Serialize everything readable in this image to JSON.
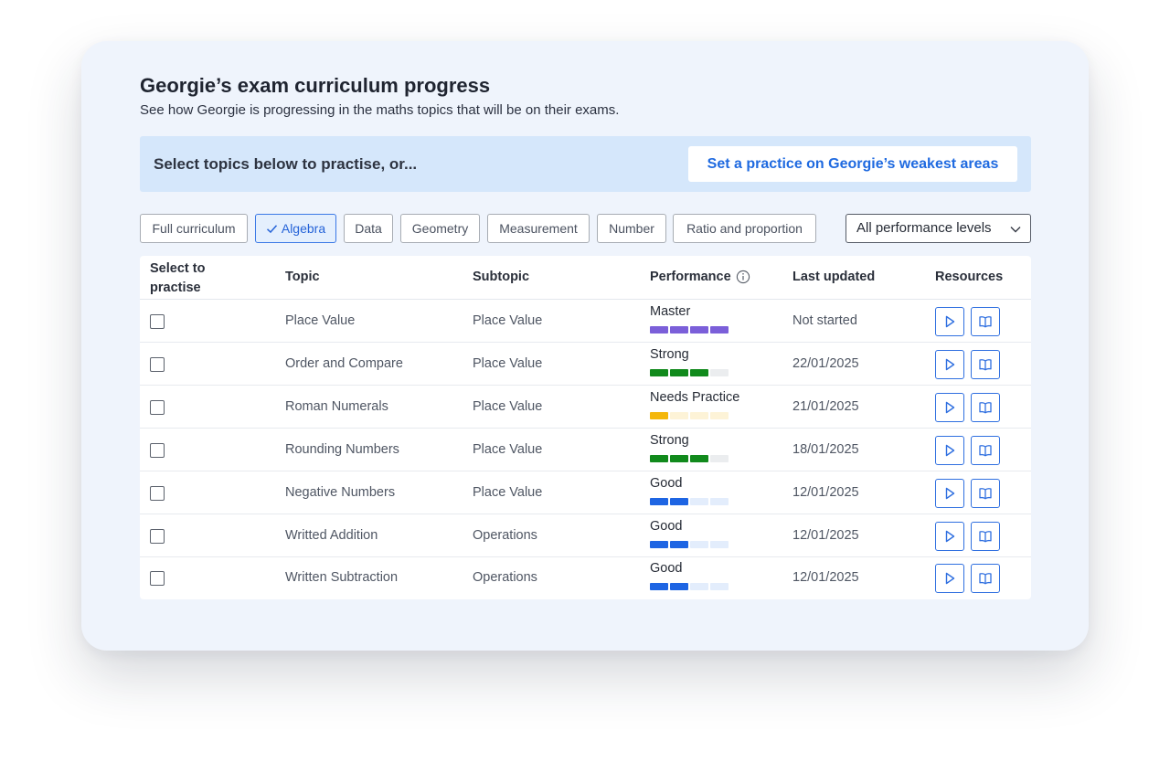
{
  "title": "Georgie’s exam curriculum progress",
  "subtitle": "See how Georgie is progressing in the maths topics that will be on their exams.",
  "banner": {
    "text": "Select topics below to practise, or...",
    "button_label": "Set a practice on Georgie’s weakest areas"
  },
  "filters": {
    "chips": [
      {
        "label": "Full curriculum",
        "active": false
      },
      {
        "label": "Algebra",
        "active": true
      },
      {
        "label": "Data",
        "active": false
      },
      {
        "label": "Geometry",
        "active": false
      },
      {
        "label": "Measurement",
        "active": false
      },
      {
        "label": "Number",
        "active": false
      },
      {
        "label": "Ratio and proportion",
        "active": false
      }
    ],
    "performance_select": "All performance levels"
  },
  "table": {
    "headers": {
      "select": "Select to practise",
      "topic": "Topic",
      "subtopic": "Subtopic",
      "performance": "Performance",
      "last_updated": "Last updated",
      "resources": "Resources"
    },
    "rows": [
      {
        "topic": "Place Value",
        "subtopic": "Place Value",
        "performance": "Master",
        "level": 4,
        "color": "#7b5fd9",
        "track": "#e9e5f8",
        "last_updated": "Not started"
      },
      {
        "topic": "Order and Compare",
        "subtopic": "Place Value",
        "performance": "Strong",
        "level": 3,
        "color": "#118a1c",
        "track": "#ebedef",
        "last_updated": "22/01/2025"
      },
      {
        "topic": "Roman Numerals",
        "subtopic": "Place Value",
        "performance": "Needs Practice",
        "level": 1,
        "color": "#f4b70c",
        "track": "#fdf3d7",
        "last_updated": "21/01/2025"
      },
      {
        "topic": "Rounding Numbers",
        "subtopic": "Place Value",
        "performance": "Strong",
        "level": 3,
        "color": "#118a1c",
        "track": "#ebedef",
        "last_updated": "18/01/2025"
      },
      {
        "topic": "Negative Numbers",
        "subtopic": "Place Value",
        "performance": "Good",
        "level": 2,
        "color": "#1e65e3",
        "track": "#e3edfc",
        "last_updated": "12/01/2025"
      },
      {
        "topic": "Writted Addition",
        "subtopic": "Operations",
        "performance": "Good",
        "level": 2,
        "color": "#1e65e3",
        "track": "#e3edfc",
        "last_updated": "12/01/2025"
      },
      {
        "topic": "Written Subtraction",
        "subtopic": "Operations",
        "performance": "Good",
        "level": 2,
        "color": "#1e65e3",
        "track": "#e3edfc",
        "last_updated": "12/01/2025"
      }
    ],
    "icons": {
      "video": "play-icon",
      "book": "book-icon",
      "info": "info-icon"
    }
  }
}
